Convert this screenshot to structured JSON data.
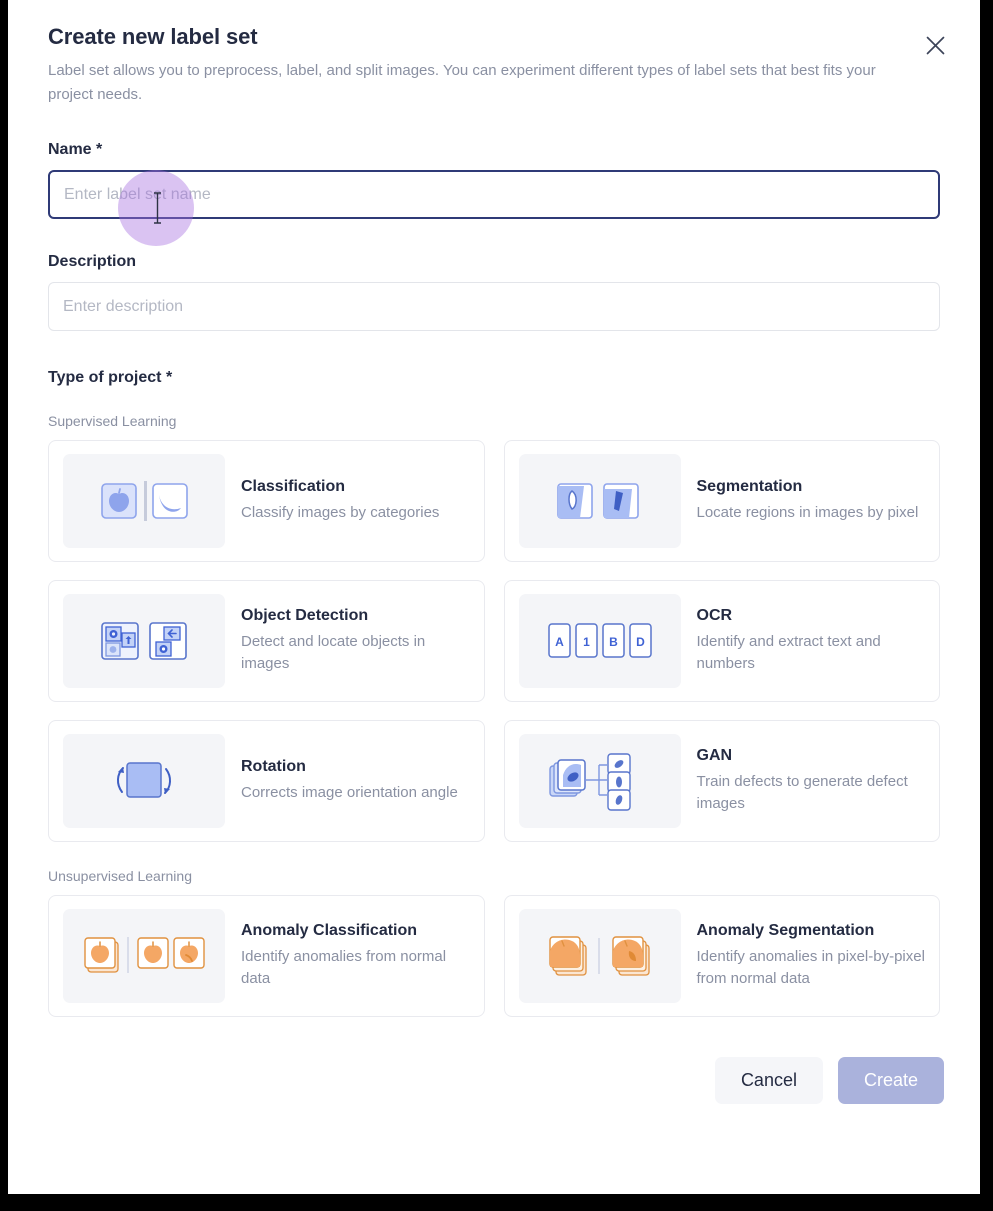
{
  "dialog": {
    "title": "Create new label set",
    "subtitle": "Label set allows you to preprocess, label, and split images. You can experiment different types of label sets that best fits your project needs.",
    "close_icon": "close-icon"
  },
  "form": {
    "name": {
      "label": "Name *",
      "placeholder": "Enter label set name",
      "value": "",
      "focused": true
    },
    "description": {
      "label": "Description",
      "placeholder": "Enter description",
      "value": "",
      "focused": false
    }
  },
  "project_type": {
    "section_title": "Type of project *",
    "groups": [
      {
        "label": "Supervised Learning",
        "cards": [
          {
            "title": "Classification",
            "desc": "Classify images by categories",
            "icon": "apple-banana-classification-icon",
            "accent": "#7d96e8"
          },
          {
            "title": "Segmentation",
            "desc": "Locate regions in images by pixel",
            "icon": "region-mask-segmentation-icon",
            "accent": "#7d96e8"
          },
          {
            "title": "Object Detection",
            "desc": "Detect and locate objects in images",
            "icon": "bounding-box-detection-icon",
            "accent": "#3f62d4"
          },
          {
            "title": "OCR",
            "desc": "Identify and extract text and numbers",
            "icon": "character-boxes-ocr-icon",
            "accent": "#3f62d4",
            "glyphs": [
              "A",
              "1",
              "B",
              "D"
            ]
          },
          {
            "title": "Rotation",
            "desc": "Corrects image orientation angle",
            "icon": "rotate-square-icon",
            "accent": "#4a6ad8"
          },
          {
            "title": "GAN",
            "desc": "Train defects to generate defect images",
            "icon": "gan-generate-icon",
            "accent": "#7d96e8"
          }
        ]
      },
      {
        "label": "Unsupervised Learning",
        "cards": [
          {
            "title": "Anomaly Classification",
            "desc": "Identify anomalies from normal data",
            "icon": "anomaly-classification-icon",
            "accent": "#f0a060"
          },
          {
            "title": "Anomaly Segmentation",
            "desc": "Identify anomalies in pixel-by-pixel from normal data",
            "icon": "anomaly-segmentation-icon",
            "accent": "#f0a060"
          }
        ]
      }
    ]
  },
  "footer": {
    "cancel_label": "Cancel",
    "create_label": "Create",
    "create_disabled": true
  },
  "colors": {
    "title": "#242b42",
    "muted": "#8a90a2",
    "focus_border": "#2f3a77",
    "create_button": "#aab2dc",
    "cancel_button": "#f5f6f9",
    "card_border": "#e9eaef",
    "icon_box": "#f4f5f8",
    "click_indicator": "#a771e0"
  }
}
